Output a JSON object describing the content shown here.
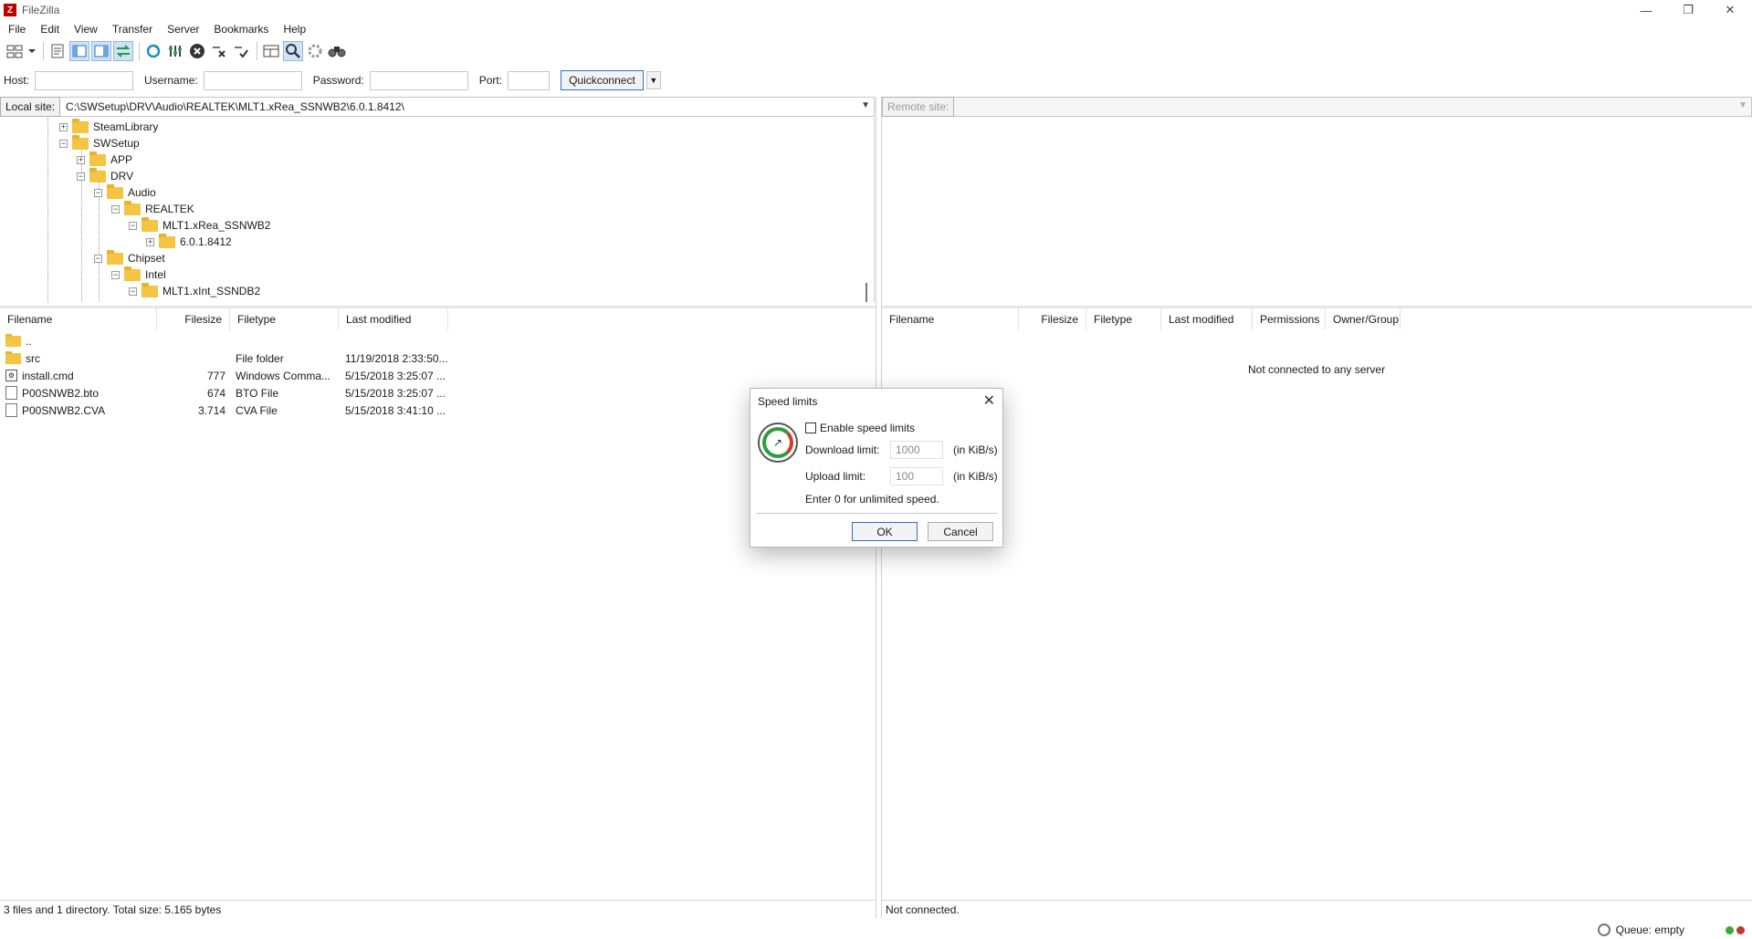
{
  "app": {
    "title": "FileZilla",
    "logo_letter": "Z"
  },
  "window_controls": {
    "minimize": "—",
    "maximize": "❐",
    "close": "✕"
  },
  "menu": [
    "File",
    "Edit",
    "View",
    "Transfer",
    "Server",
    "Bookmarks",
    "Help"
  ],
  "toolbar": {
    "icons": [
      "site-manager-icon",
      "dropdown-arrow-icon",
      "toggle-message-log-icon",
      "toggle-local-tree-icon",
      "toggle-remote-tree-icon",
      "toggle-transfer-queue-icon",
      "refresh-icon",
      "process-queue-icon",
      "cancel-operation-icon",
      "disconnect-icon",
      "reconnect-icon",
      "directory-filters-icon",
      "toggle-sync-browsing-icon",
      "directory-comparison-icon",
      "search-remote-files-icon"
    ]
  },
  "quickconnect": {
    "host_label": "Host:",
    "username_label": "Username:",
    "password_label": "Password:",
    "port_label": "Port:",
    "host_value": "",
    "username_value": "",
    "password_value": "",
    "port_value": "",
    "button_label": "Quickconnect"
  },
  "local_site": {
    "label": "Local site:",
    "path": "C:\\SWSetup\\DRV\\Audio\\REALTEK\\MLT1.xRea_SSNWB2\\6.0.1.8412\\"
  },
  "remote_site": {
    "label": "Remote site:",
    "path": ""
  },
  "tree": [
    {
      "name": "SteamLibrary",
      "expander": "+"
    },
    {
      "name": "SWSetup",
      "expander": "−"
    },
    {
      "name": "APP",
      "expander": "+"
    },
    {
      "name": "DRV",
      "expander": "−"
    },
    {
      "name": "Audio",
      "expander": "−"
    },
    {
      "name": "REALTEK",
      "expander": "−"
    },
    {
      "name": "MLT1.xRea_SSNWB2",
      "expander": "−"
    },
    {
      "name": "6.0.1.8412",
      "expander": "+"
    },
    {
      "name": "Chipset",
      "expander": "−"
    },
    {
      "name": "Intel",
      "expander": "−"
    },
    {
      "name": "MLT1.xInt_SSNDB2",
      "expander": "−"
    }
  ],
  "local_columns": [
    "Filename",
    "Filesize",
    "Filetype",
    "Last modified"
  ],
  "local_files": [
    {
      "name": "..",
      "size": "",
      "type": "",
      "modified": "",
      "icon": "folder-icon"
    },
    {
      "name": "src",
      "size": "",
      "type": "File folder",
      "modified": "11/19/2018 2:33:50...",
      "icon": "folder-icon"
    },
    {
      "name": "install.cmd",
      "size": "777",
      "type": "Windows Comma...",
      "modified": "5/15/2018 3:25:07 ...",
      "icon": "command-file-icon"
    },
    {
      "name": "P00SNWB2.bto",
      "size": "674",
      "type": "BTO File",
      "modified": "5/15/2018 3:25:07 ...",
      "icon": "file-icon"
    },
    {
      "name": "P00SNWB2.CVA",
      "size": "3.714",
      "type": "CVA File",
      "modified": "5/15/2018 3:41:10 ...",
      "icon": "file-icon"
    }
  ],
  "remote_columns": [
    "Filename",
    "Filesize",
    "Filetype",
    "Last modified",
    "Permissions",
    "Owner/Group"
  ],
  "remote_empty_message": "Not connected to any server",
  "local_status": "3 files and 1 directory. Total size: 5.165 bytes",
  "remote_status": "Not connected.",
  "queue_status": "Queue: empty",
  "leds": {
    "upload": "#3aa83a",
    "download": "#c0392b"
  },
  "dialog": {
    "title": "Speed limits",
    "close": "✕",
    "enable_label": "Enable speed limits",
    "enable_checked": false,
    "download_label": "Download limit:",
    "download_value": "1000",
    "download_unit": "(in KiB/s)",
    "upload_label": "Upload limit:",
    "upload_value": "100",
    "upload_unit": "(in KiB/s)",
    "hint": "Enter 0 for unlimited speed.",
    "ok_label": "OK",
    "cancel_label": "Cancel"
  }
}
